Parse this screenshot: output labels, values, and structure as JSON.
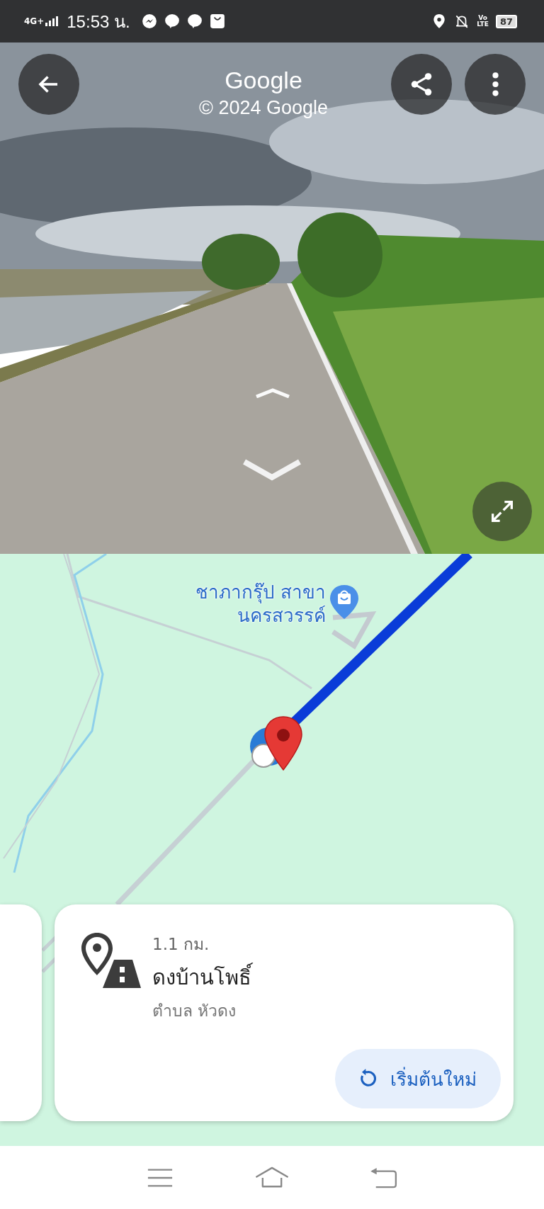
{
  "status_bar": {
    "network": "4G+",
    "time": "15:53 น.",
    "volte_top": "Vo",
    "volte_bottom": "LTE",
    "battery": "87"
  },
  "street_view": {
    "title": "Google",
    "copyright": "© 2024 Google"
  },
  "map": {
    "place_label": "ชาภากรุ๊ป สาขา\nนครสวรรค์"
  },
  "card": {
    "distance": "1.1 กม.",
    "name": "ดงบ้านโพธิ์",
    "area": "ตำบล หัวดง",
    "restart_button": "เริ่มต้นใหม่"
  }
}
